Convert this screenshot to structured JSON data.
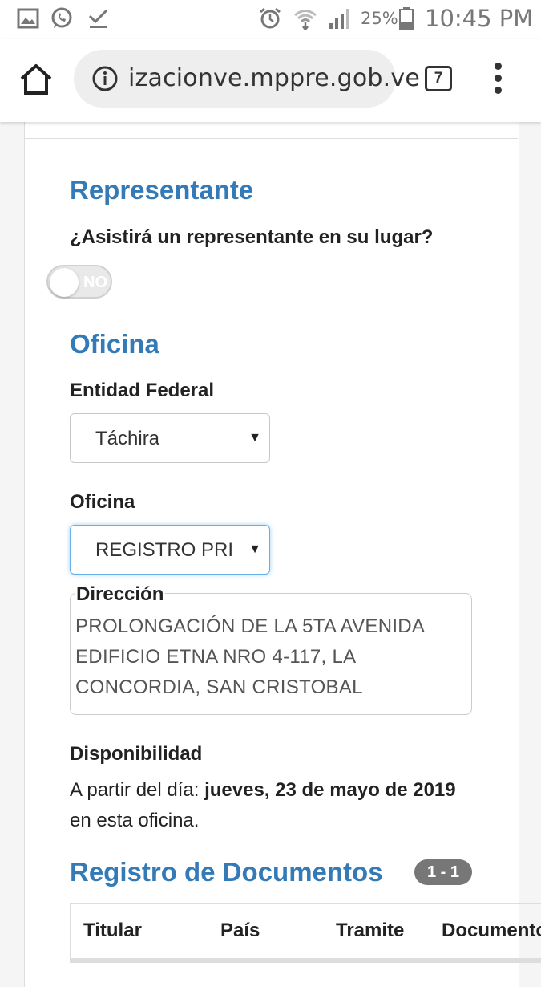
{
  "status_bar": {
    "battery": "25%",
    "time": "10:45 PM"
  },
  "browser": {
    "url": "izacionve.mppre.gob.ve",
    "tab_count": "7"
  },
  "representante": {
    "title": "Representante",
    "question": "¿Asistirá un representante en su lugar?",
    "toggle_label": "NO",
    "toggle_on": false
  },
  "oficina": {
    "title": "Oficina",
    "entidad_label": "Entidad Federal",
    "entidad_value": "Táchira",
    "oficina_label": "Oficina",
    "oficina_value": "REGISTRO PRI",
    "direccion_label": "Dirección",
    "direccion_text": "PROLONGACIÓN DE LA 5TA AVENIDA EDIFICIO ETNA NRO 4-117, LA CONCORDIA, SAN CRISTOBAL"
  },
  "disponibilidad": {
    "label": "Disponibilidad",
    "prefix": "A partir del día: ",
    "date": "jueves, 23 de mayo de 2019",
    "suffix": " en esta oficina."
  },
  "registro": {
    "title": "Registro de Documentos",
    "badge": "1 - 1",
    "columns": [
      "Titular",
      "País",
      "Tramite",
      "Documento"
    ]
  }
}
